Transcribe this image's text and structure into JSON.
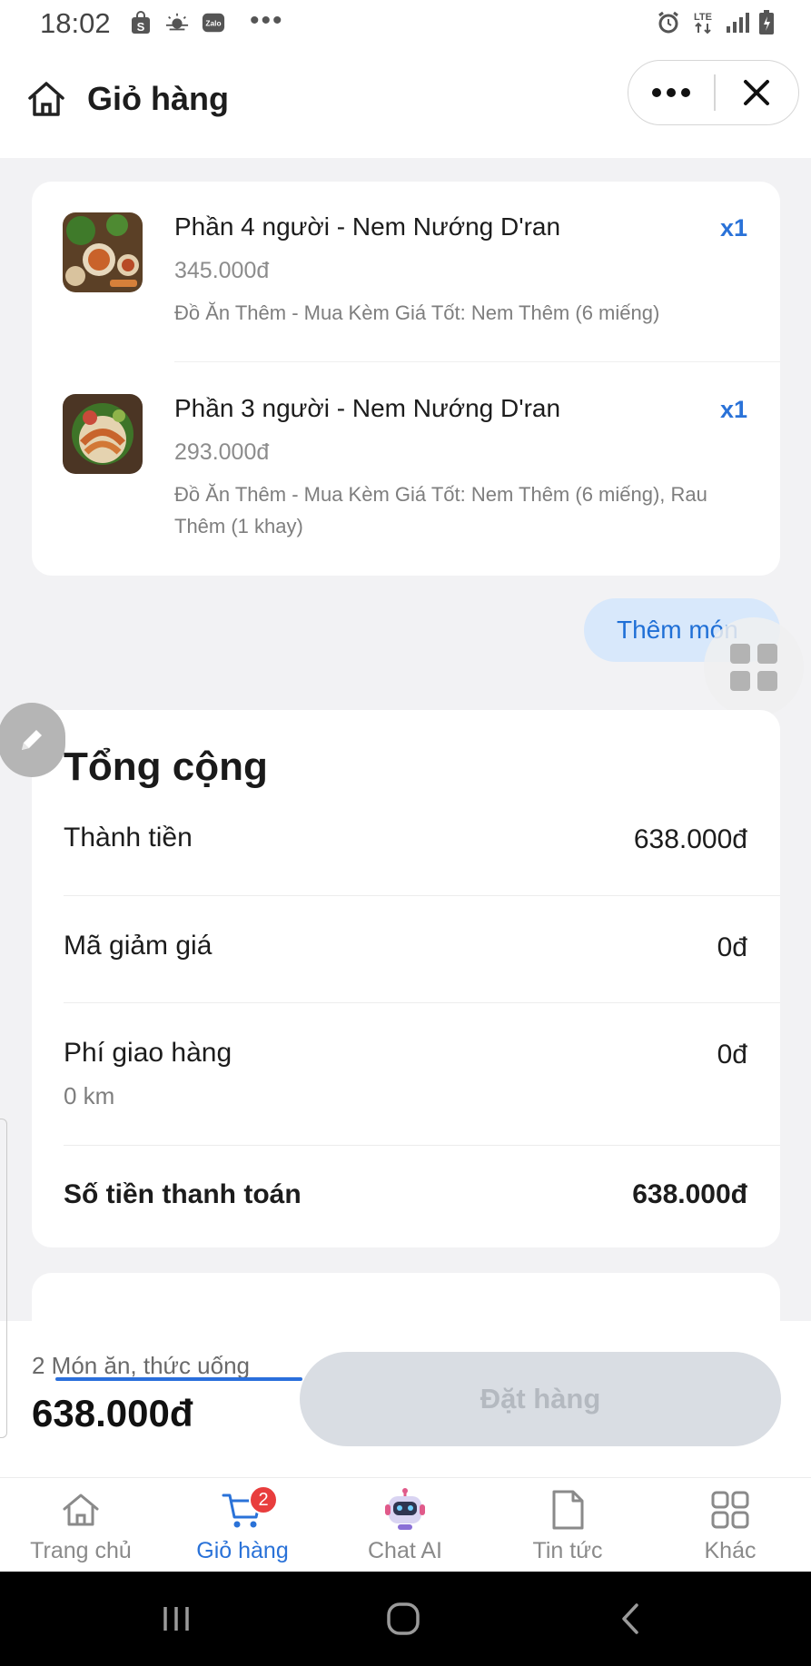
{
  "status_bar": {
    "time": "18:02",
    "network": "LTE",
    "left_icons": [
      "shopee-icon",
      "weather-icon",
      "zalo-icon"
    ],
    "right_icons": [
      "alarm-icon",
      "lte-icon",
      "signal-icon",
      "battery-icon"
    ]
  },
  "header": {
    "title": "Giỏ hàng",
    "more_icon": "more-dots-icon",
    "close_icon": "close-icon"
  },
  "cart": {
    "items": [
      {
        "name": "Phần 4 người - Nem Nướng D'ran",
        "price": "345.000đ",
        "note": "Đồ Ăn Thêm - Mua Kèm Giá Tốt: Nem Thêm (6 miếng)",
        "quantity": "x1"
      },
      {
        "name": "Phần 3 người - Nem Nướng D'ran",
        "price": "293.000đ",
        "note": "Đồ Ăn Thêm - Mua Kèm Giá Tốt: Nem Thêm (6 miếng), Rau Thêm (1 khay)",
        "quantity": "x1"
      }
    ],
    "add_more_label": "Thêm món"
  },
  "summary": {
    "title": "Tổng cộng",
    "subtotal_label": "Thành tiền",
    "subtotal_value": "638.000đ",
    "discount_label": "Mã giảm giá",
    "discount_value": "0đ",
    "shipping_label": "Phí giao hàng",
    "shipping_distance": "0 km",
    "shipping_value": "0đ",
    "payable_label": "Số tiền thanh toán",
    "payable_value": "638.000đ"
  },
  "checkout": {
    "count_label": "2 Món ăn, thức uống",
    "total": "638.000đ",
    "order_button": "Đặt hàng"
  },
  "tabbar": {
    "items": [
      {
        "label": "Trang chủ",
        "icon": "home-icon"
      },
      {
        "label": "Giỏ hàng",
        "icon": "cart-icon",
        "badge": "2",
        "active": true
      },
      {
        "label": "Chat AI",
        "icon": "robot-icon"
      },
      {
        "label": "Tin tức",
        "icon": "document-icon"
      },
      {
        "label": "Khác",
        "icon": "grid-icon"
      }
    ]
  },
  "colors": {
    "accent": "#2a72d8",
    "badge": "#e83d3d",
    "background": "#f2f2f4"
  }
}
